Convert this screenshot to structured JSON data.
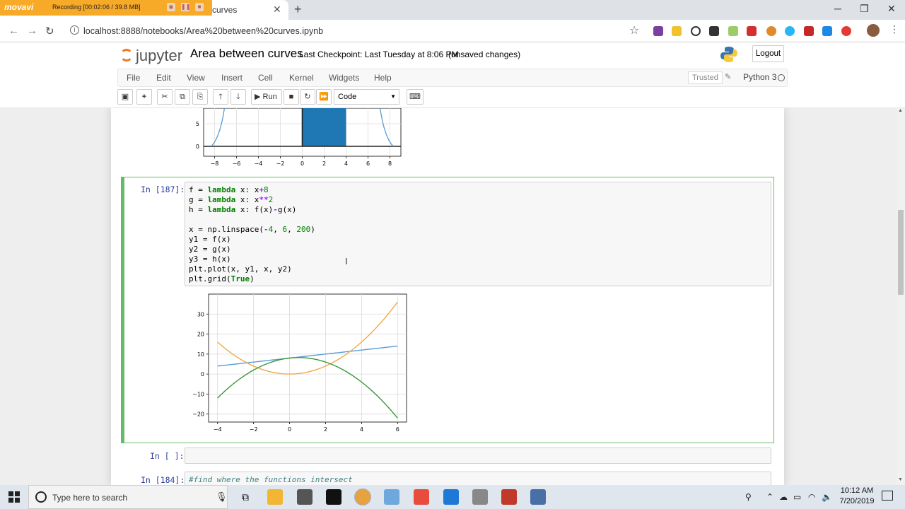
{
  "recorder": {
    "brand": "movavi",
    "status": "Recording   [00:02:06 / 39.8 MB]"
  },
  "browser": {
    "tab_title": "curves",
    "url": "localhost:8888/notebooks/Area%20between%20curves.ipynb"
  },
  "jupyter": {
    "logo_text": "jupyter",
    "notebook_name": "Area between curves",
    "checkpoint": "Last Checkpoint: Last Tuesday at 8:06 PM",
    "unsaved": "(unsaved changes)",
    "logout_label": "Logout",
    "menu": [
      "File",
      "Edit",
      "View",
      "Insert",
      "Cell",
      "Kernel",
      "Widgets",
      "Help"
    ],
    "trusted_label": "Trusted",
    "kernel_name": "Python 3",
    "run_label": "Run",
    "cell_type": "Code"
  },
  "cells": {
    "cell187": {
      "prompt": "In [187]:",
      "code": [
        "f = lambda x: x+8",
        "g = lambda x: x**2",
        "h = lambda x: f(x)-g(x)",
        "",
        "x = np.linspace(-4, 6, 200)",
        "y1 = f(x)",
        "y2 = g(x)",
        "y3 = h(x)",
        "plt.plot(x, y1, x, y2)",
        "plt.grid(True)"
      ]
    },
    "cell_empty": {
      "prompt": "In [ ]:"
    },
    "cell184": {
      "prompt": "In [184]:",
      "code": "#find where the functions intersect"
    }
  },
  "taskbar": {
    "search_placeholder": "Type here to search",
    "time": "10:12 AM",
    "date": "7/20/2019"
  },
  "chart_data": [
    {
      "type": "bar",
      "x_ticks": [
        "−8",
        "−6",
        "−4",
        "−2",
        "0",
        "2",
        "4",
        "6",
        "8"
      ],
      "y_ticks": [
        "5",
        "0"
      ],
      "xlim": [
        -9,
        9
      ],
      "note_visible": "partially visible chart (cropped at top)",
      "bar_region": [
        0,
        4
      ],
      "colors": {
        "curve": "#5b9bd5",
        "fill": "#1f77b4"
      }
    },
    {
      "type": "line",
      "xlim": [
        -4.5,
        6.5
      ],
      "ylim": [
        -24,
        40
      ],
      "x_ticks": [
        "−4",
        "−2",
        "0",
        "2",
        "4",
        "6"
      ],
      "x_tick_values": [
        -4,
        -2,
        0,
        2,
        4,
        6
      ],
      "y_ticks": [
        "30",
        "20",
        "10",
        "0",
        "−10",
        "−20"
      ],
      "y_tick_values": [
        30,
        20,
        10,
        0,
        -10,
        -20
      ],
      "grid": true,
      "series": [
        {
          "function": "x+8",
          "color": "#5b9bd5",
          "x": [
            -4,
            6
          ],
          "y": [
            4,
            14
          ]
        },
        {
          "function": "x**2",
          "color": "#f0a84a",
          "x_range": [
            -4,
            6
          ]
        },
        {
          "function": "x+8-x**2",
          "color": "#3a9a3a",
          "x_range": [
            -4,
            6
          ]
        }
      ]
    }
  ]
}
